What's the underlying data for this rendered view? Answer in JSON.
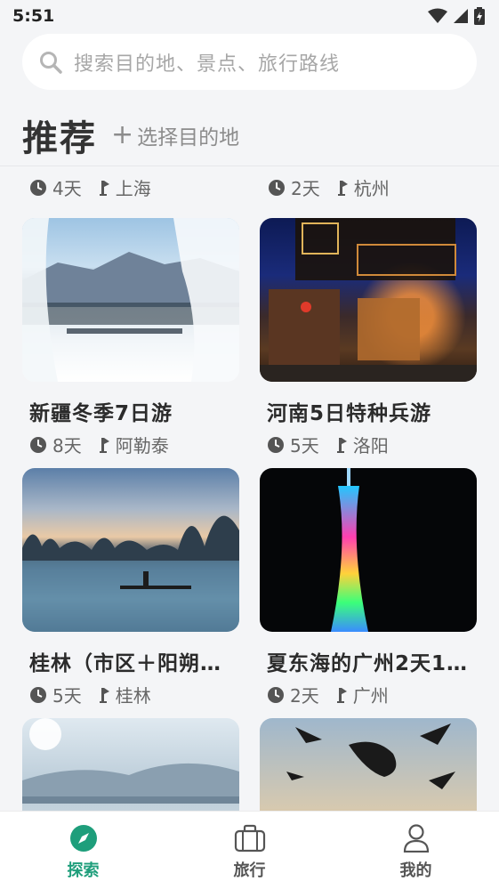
{
  "status_bar": {
    "time": "5:51"
  },
  "search": {
    "placeholder": "搜索目的地、景点、旅行路线"
  },
  "header": {
    "title": "推荐",
    "choose_destination": "选择目的地",
    "plus": "+"
  },
  "cut_row": [
    {
      "days": "4天",
      "city": "上海"
    },
    {
      "days": "2天",
      "city": "杭州"
    }
  ],
  "trips": [
    {
      "title": "新疆冬季7日游",
      "days": "8天",
      "city": "阿勒泰"
    },
    {
      "title": "河南5日特种兵游",
      "days": "5天",
      "city": "洛阳"
    },
    {
      "title": "桂林（市区＋阳朔…",
      "days": "5天",
      "city": "桂林"
    },
    {
      "title": "夏东海的广州2天1…",
      "days": "2天",
      "city": "广州"
    }
  ],
  "nav": [
    {
      "label": "探索",
      "active": true
    },
    {
      "label": "旅行",
      "active": false
    },
    {
      "label": "我的",
      "active": false
    }
  ],
  "colors": {
    "accent": "#1e9e7b",
    "background": "#f4f5f7"
  }
}
